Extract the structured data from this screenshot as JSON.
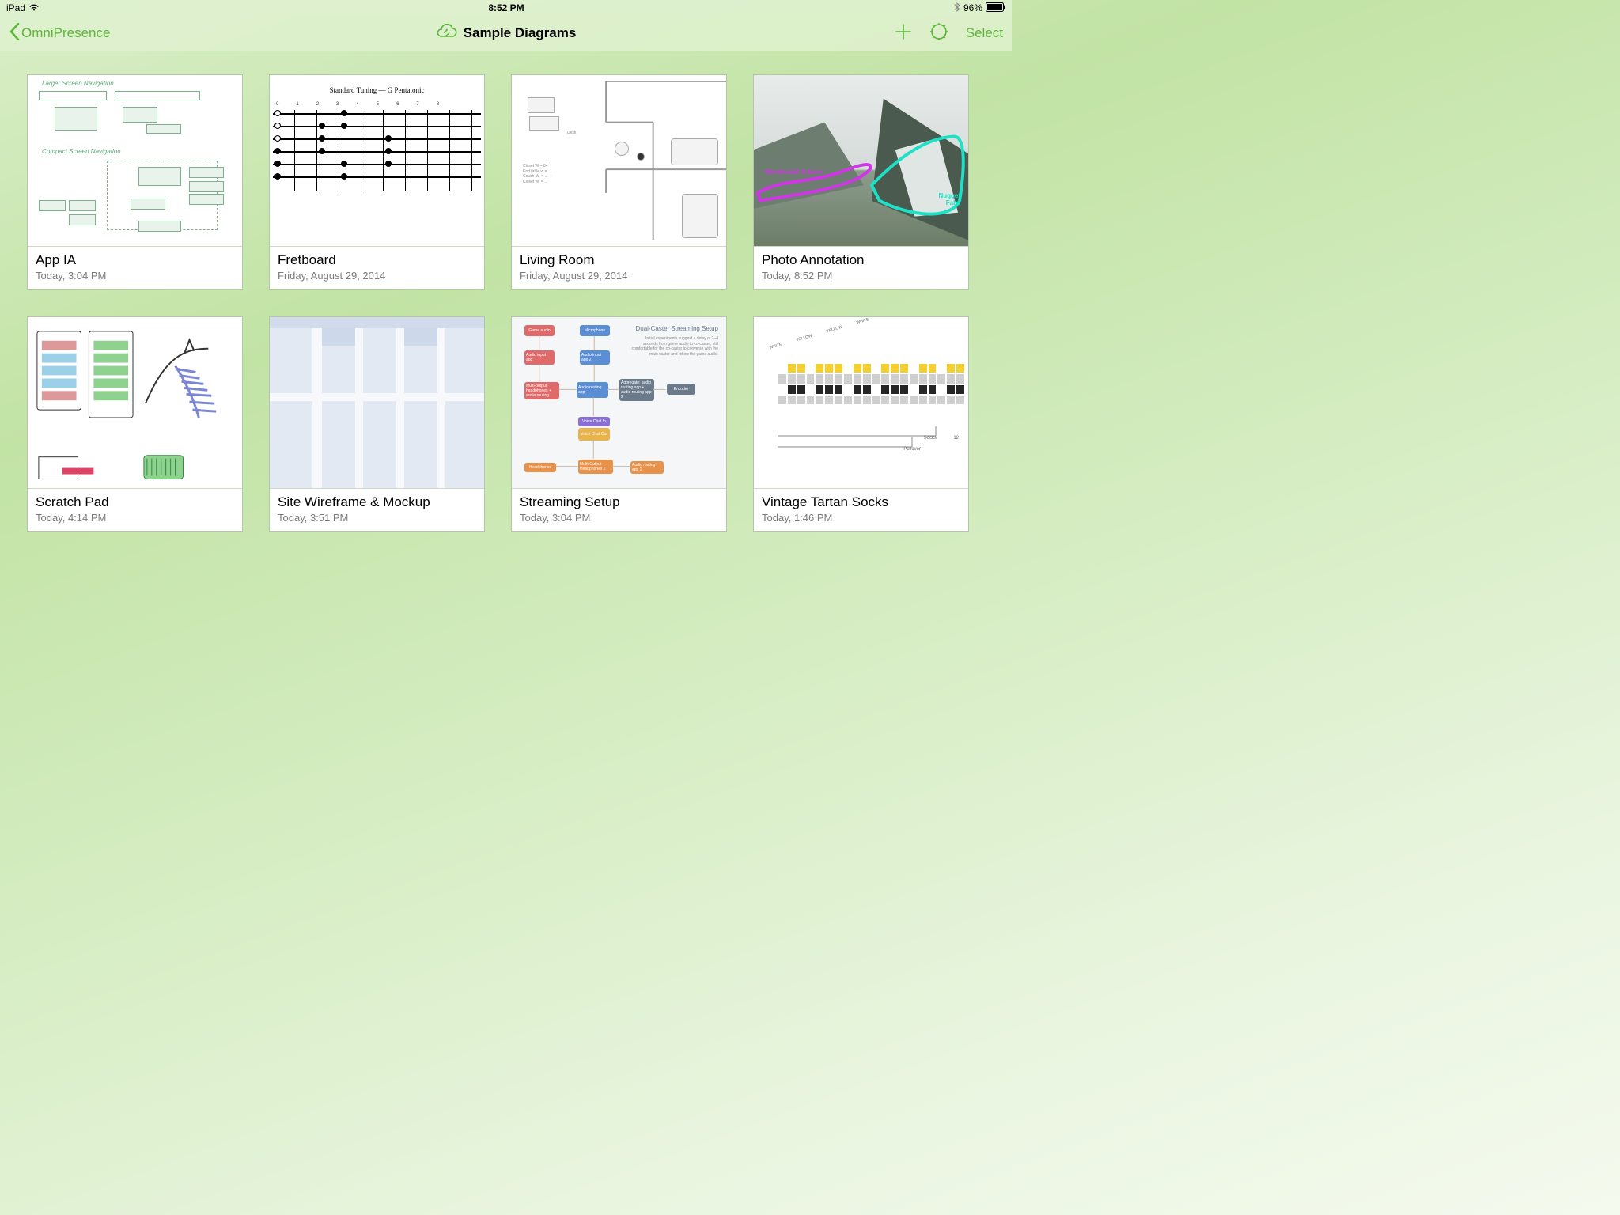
{
  "status": {
    "device": "iPad",
    "time": "8:52 PM",
    "battery_pct": "96%"
  },
  "nav": {
    "back_label": "OmniPresence",
    "title": "Sample Diagrams",
    "select_label": "Select"
  },
  "documents": [
    {
      "title": "App IA",
      "date": "Today, 3:04 PM"
    },
    {
      "title": "Fretboard",
      "date": "Friday, August 29, 2014"
    },
    {
      "title": "Living Room",
      "date": "Friday, August 29, 2014"
    },
    {
      "title": "Photo Annotation",
      "date": "Today, 8:52 PM"
    },
    {
      "title": "Scratch Pad",
      "date": "Today, 4:14 PM"
    },
    {
      "title": "Site Wireframe & Mockup",
      "date": "Today, 3:51 PM"
    },
    {
      "title": "Streaming Setup",
      "date": "Today, 3:04 PM"
    },
    {
      "title": "Vintage Tartan Socks",
      "date": "Today, 1:46 PM"
    }
  ],
  "thumbs": {
    "app_ia": {
      "h1": "Larger Screen Navigation",
      "h2": "Compact Screen Navigation"
    },
    "fretboard": {
      "title": "Standard Tuning — G Pentatonic"
    },
    "photo": {
      "label1": "Mendenhall Glacier",
      "label2": "Nugget Falls"
    },
    "streaming": {
      "title": "Dual-Caster Streaming Setup"
    },
    "tartan": {
      "l1": "Socks",
      "l2": "Pullover",
      "n": "12"
    }
  }
}
